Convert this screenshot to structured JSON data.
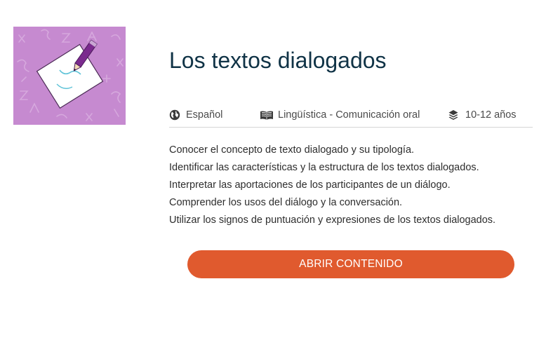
{
  "card": {
    "title": "Los textos dialogados",
    "thumbnail": {
      "icon": "writing-document-icon",
      "background_color": "#c68ad0"
    },
    "meta": {
      "language": {
        "icon": "globe-icon",
        "label": "Español"
      },
      "subject": {
        "icon": "open-book-icon",
        "label": "Lingüística - Comunicación oral"
      },
      "age": {
        "icon": "layers-icon",
        "label": "10-12 años"
      }
    },
    "objectives": [
      "Conocer el concepto de texto dialogado y su tipología.",
      "Identificar las características y la estructura de los textos dialogados.",
      "Interpretar las aportaciones de los participantes de un diálogo.",
      "Comprender los usos del diálogo y la conversación.",
      "Utilizar los signos de puntuación y expresiones de los textos dialogados."
    ],
    "open_button_label": "ABRIR CONTENIDO"
  },
  "colors": {
    "title": "#103346",
    "button": "#e05a2e",
    "thumbnail_bg": "#c68ad0",
    "pencil": "#7b2a8e"
  }
}
